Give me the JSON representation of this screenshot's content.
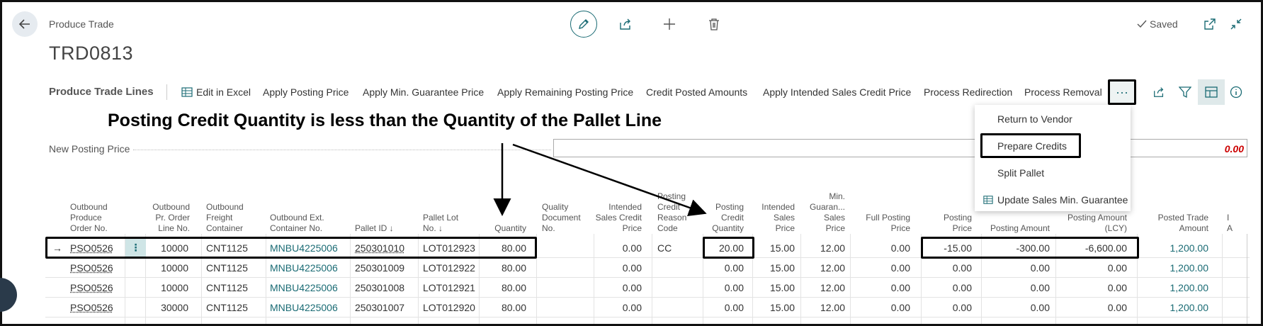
{
  "header": {
    "caption": "Produce Trade",
    "title": "TRD0813",
    "saved_label": "Saved"
  },
  "actions": {
    "section_title": "Produce Trade Lines",
    "items": [
      "Edit in Excel",
      "Apply Posting Price",
      "Apply Min. Guarantee Price",
      "Apply Remaining Posting Price",
      "Credit Posted Amounts",
      "Apply Intended Sales Credit Price",
      "Process Redirection",
      "Process Removal"
    ],
    "more_label": "···"
  },
  "annotation": {
    "text": "Posting Credit Quantity is less than the Quantity of the Pallet Line"
  },
  "posting_price": {
    "label": "New Posting Price",
    "value": "0.00"
  },
  "dropdown": {
    "items": [
      "Return to Vendor",
      "Prepare Credits",
      "Split Pallet",
      "Update Sales Min. Guarantee"
    ]
  },
  "table": {
    "columns": [
      [
        "Outbound",
        "Produce",
        "Order No."
      ],
      [
        "Outbound",
        "Pr. Order",
        "Line No."
      ],
      [
        "Outbound",
        "Freight",
        "Container"
      ],
      [
        "Outbound Ext.",
        "Container No."
      ],
      [
        "Pallet ID ↓"
      ],
      [
        "Pallet Lot",
        "No. ↓"
      ],
      [
        "Quantity"
      ],
      [
        "Quality",
        "Document",
        "No."
      ],
      [
        "Intended",
        "Sales Credit",
        "Price"
      ],
      [
        "Posting",
        "Credit",
        "Reason",
        "Code"
      ],
      [
        "Posting",
        "Credit",
        "Quantity"
      ],
      [
        "Intended",
        "Sales",
        "Price"
      ],
      [
        "Min.",
        "Guaran...",
        "Sales",
        "Price"
      ],
      [
        "Full Posting",
        "Price"
      ],
      [
        "Posting",
        "Price"
      ],
      [
        "Posting Amount"
      ],
      [
        "Posting Amount",
        "(LCY)"
      ],
      [
        "Posted Trade",
        "Amount"
      ],
      [
        "I",
        "A"
      ]
    ],
    "rows": [
      [
        "PSO0526",
        "10000",
        "CNT1125",
        "MNBU4225006",
        "250301010",
        "LOT012923",
        "80.00",
        "",
        "0.00",
        "CC",
        "20.00",
        "15.00",
        "12.00",
        "0.00",
        "-15.00",
        "-300.00",
        "-6,600.00",
        "1,200.00"
      ],
      [
        "PSO0526",
        "10000",
        "CNT1125",
        "MNBU4225006",
        "250301009",
        "LOT012922",
        "80.00",
        "",
        "0.00",
        "",
        "0.00",
        "15.00",
        "12.00",
        "0.00",
        "0.00",
        "0.00",
        "0.00",
        "1,200.00"
      ],
      [
        "PSO0526",
        "10000",
        "CNT1125",
        "MNBU4225006",
        "250301008",
        "LOT012921",
        "80.00",
        "",
        "0.00",
        "",
        "0.00",
        "15.00",
        "12.00",
        "0.00",
        "0.00",
        "0.00",
        "0.00",
        "1,200.00"
      ],
      [
        "PSO0526",
        "30000",
        "CNT1125",
        "MNBU4225006",
        "250301007",
        "LOT012920",
        "80.00",
        "",
        "0.00",
        "",
        "0.00",
        "15.00",
        "12.00",
        "0.00",
        "0.00",
        "0.00",
        "0.00",
        "1,200.00"
      ]
    ],
    "row_marker": "→",
    "row_menu": "⋮"
  },
  "colors": {
    "accent": "#1a6b74",
    "negative_value": "#cc0000",
    "annotation": "#000000"
  },
  "icons": [
    "back-arrow-icon",
    "pencil-icon",
    "share-icon",
    "plus-icon",
    "trash-icon",
    "check-icon",
    "open-new-window-icon",
    "collapse-icon",
    "excel-icon",
    "filter-icon",
    "personalize-icon",
    "info-icon"
  ]
}
